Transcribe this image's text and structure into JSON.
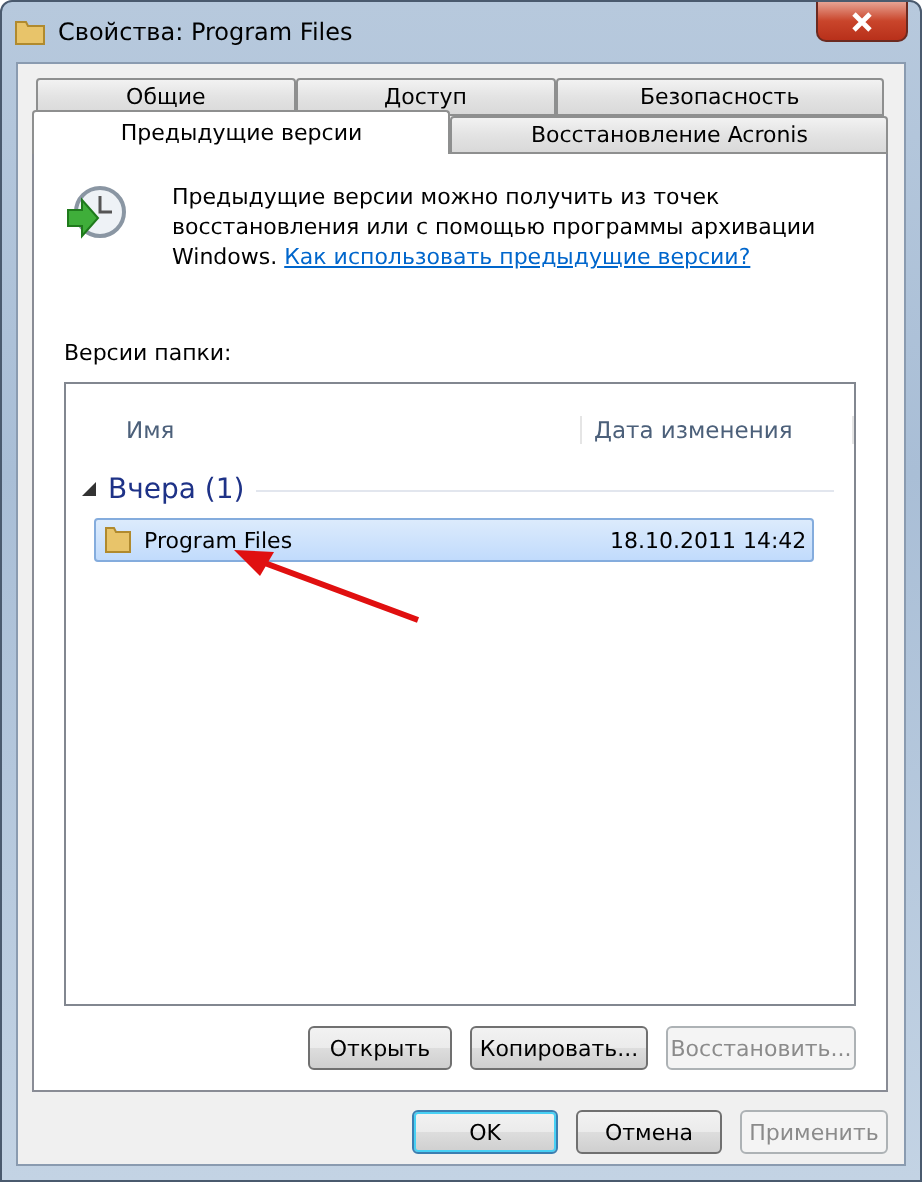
{
  "window": {
    "title": "Свойства: Program Files"
  },
  "tab_rows": [
    [
      {
        "label": "Общие",
        "selected": false
      },
      {
        "label": "Доступ",
        "selected": false
      },
      {
        "label": "Безопасность",
        "selected": false
      }
    ],
    [
      {
        "label": "Предыдущие версии",
        "selected": true
      },
      {
        "label": "Восстановление Acronis",
        "selected": false
      }
    ]
  ],
  "description": {
    "text": "Предыдущие версии можно получить из точек восстановления или с помощью программы архивации Windows.",
    "link": "Как использовать предыдущие версии?"
  },
  "list_label": "Версии папки:",
  "columns": [
    "Имя",
    "Дата изменения"
  ],
  "groups": [
    {
      "title": "Вчера (1)",
      "expanded": true,
      "rows": [
        {
          "name": "Program Files",
          "date": "18.10.2011 14:42",
          "selected": true
        }
      ]
    }
  ],
  "actions": [
    {
      "label": "Открыть",
      "disabled": false
    },
    {
      "label": "Копировать...",
      "disabled": false
    },
    {
      "label": "Восстановить...",
      "disabled": true
    }
  ],
  "dialog_buttons": [
    {
      "label": "OK",
      "default": true,
      "disabled": false
    },
    {
      "label": "Отмена",
      "default": false,
      "disabled": false
    },
    {
      "label": "Применить",
      "default": false,
      "disabled": true
    }
  ]
}
